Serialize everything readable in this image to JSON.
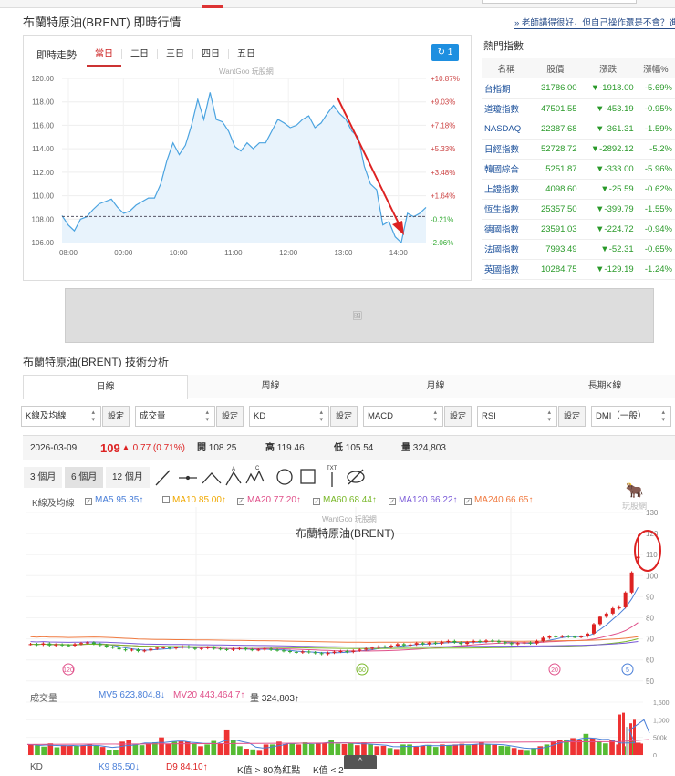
{
  "header": {
    "title": "布蘭特原油(BRENT) 即時行情",
    "promo_link": "» 老師講得很好，但自己操作還是不會？進"
  },
  "intraday": {
    "label": "即時走勢",
    "tabs": [
      "當日",
      "二日",
      "三日",
      "四日",
      "五日"
    ],
    "active_tab": 0,
    "refresh_label": "1",
    "watermark": "WantGoo 玩股網"
  },
  "hot_indices": {
    "title": "熱門指數",
    "columns": [
      "名稱",
      "股價",
      "漲跌",
      "漲幅%"
    ],
    "rows": [
      [
        "台指期",
        "31786.00",
        "▼-1918.00",
        "-5.69%"
      ],
      [
        "道瓊指數",
        "47501.55",
        "▼-453.19",
        "-0.95%"
      ],
      [
        "NASDAQ",
        "22387.68",
        "▼-361.31",
        "-1.59%"
      ],
      [
        "日經指數",
        "52728.72",
        "▼-2892.12",
        "-5.2%"
      ],
      [
        "韓國綜合",
        "5251.87",
        "▼-333.00",
        "-5.96%"
      ],
      [
        "上證指數",
        "4098.60",
        "▼-25.59",
        "-0.62%"
      ],
      [
        "恆生指數",
        "25357.50",
        "▼-399.79",
        "-1.55%"
      ],
      [
        "德國指數",
        "23591.03",
        "▼-224.72",
        "-0.94%"
      ],
      [
        "法國指數",
        "7993.49",
        "▼-52.31",
        "-0.65%"
      ],
      [
        "英國指數",
        "10284.75",
        "▼-129.19",
        "-1.24%"
      ]
    ]
  },
  "tech": {
    "title": "布蘭特原油(BRENT) 技術分析",
    "tabs": [
      "日線",
      "周線",
      "月線",
      "長期K線"
    ],
    "active_tab": 0,
    "selects": [
      {
        "value": "K線及均線",
        "btn": "設定"
      },
      {
        "value": "成交量",
        "btn": "設定"
      },
      {
        "value": "KD",
        "btn": "設定"
      },
      {
        "value": "MACD",
        "btn": "設定"
      },
      {
        "value": "RSI",
        "btn": "設定"
      },
      {
        "value": "DMI（一般）",
        "btn": "設定"
      }
    ],
    "quote": {
      "date": "2026-03-09",
      "price": "109",
      "change": "▲ 0.77 (0.71%)",
      "open_label": "開",
      "open": "108.25",
      "high_label": "高",
      "high": "119.46",
      "low_label": "低",
      "low": "105.54",
      "vol_label": "量",
      "vol": "324,803"
    },
    "ranges": [
      "3 個月",
      "6 個月",
      "12 個月"
    ],
    "active_range": 1,
    "ma_label": "K線及均線",
    "ma": [
      {
        "text": "MA5 95.35↑",
        "checked": true,
        "color": "#4a7fd8"
      },
      {
        "text": "MA10 85.00↑",
        "checked": false,
        "color": "#f0a800"
      },
      {
        "text": "MA20 77.20↑",
        "checked": true,
        "color": "#e0508a"
      },
      {
        "text": "MA60 68.44↑",
        "checked": true,
        "color": "#7ab82a"
      },
      {
        "text": "MA120 66.22↑",
        "checked": true,
        "color": "#7a5ad8"
      },
      {
        "text": "MA240 66.65↑",
        "checked": true,
        "color": "#f07a40"
      }
    ],
    "chart_title": "布蘭特原油(BRENT)",
    "watermark": "WantGoo 玩股網",
    "logo_text": "玩股網",
    "markers": [
      "120",
      "60",
      "20",
      "5"
    ],
    "vol_label": "成交量",
    "mv5": "MV5 623,804.8↓",
    "mv20": "MV20 443,464.7↑",
    "vol_now": "量 324,803↑",
    "kd_label": "KD",
    "k": "K9 85.50↓",
    "d": "D9 84.10↑",
    "kd_note1": "K值 > 80為紅點",
    "kd_note2": "K值 < 2"
  },
  "chart_data": [
    {
      "type": "line",
      "title": "即時走勢",
      "x_ticks": [
        "08:00",
        "09:00",
        "10:00",
        "11:00",
        "12:00",
        "13:00",
        "14:00"
      ],
      "ylim": [
        106,
        120
      ],
      "y_ticks": [
        "106.00",
        "108.00",
        "110.00",
        "112.00",
        "114.00",
        "116.00",
        "118.00",
        "120.00"
      ],
      "pct_ticks": [
        "-2.06%",
        "-0.21%",
        "+1.64%",
        "+3.48%",
        "+5.33%",
        "+7.18%",
        "+9.03%",
        "+10.87%"
      ],
      "reference": 108.23,
      "values": [
        108.3,
        107.5,
        107.0,
        108.0,
        108.2,
        108.8,
        109.3,
        109.5,
        109.7,
        109.0,
        108.5,
        108.7,
        109.2,
        109.5,
        109.8,
        109.8,
        111.0,
        113.0,
        114.5,
        113.5,
        114.3,
        116.0,
        118.2,
        116.5,
        118.8,
        116.5,
        116.3,
        115.5,
        114.2,
        113.8,
        114.5,
        114.0,
        114.5,
        114.5,
        115.5,
        116.5,
        116.2,
        115.8,
        116.0,
        116.5,
        116.8,
        115.8,
        116.2,
        117.0,
        117.7,
        117.0,
        116.5,
        115.5,
        115.0,
        112.5,
        111.0,
        110.5,
        107.5,
        107.8,
        106.5,
        106.0,
        108.5,
        108.2,
        108.5,
        109.0
      ]
    },
    {
      "type": "candlestick",
      "title": "布蘭特原油(BRENT)",
      "ylim": [
        50,
        130
      ],
      "y_ticks": [
        "50",
        "60",
        "70",
        "80",
        "90",
        "100",
        "110",
        "120",
        "130"
      ],
      "closes": [
        67.5,
        67.2,
        67.8,
        66.9,
        67.3,
        67.0,
        66.8,
        67.5,
        68.0,
        68.3,
        67.6,
        67.0,
        66.2,
        65.8,
        65.0,
        64.6,
        64.9,
        64.2,
        64.5,
        65.3,
        65.8,
        66.0,
        65.5,
        65.9,
        66.4,
        65.8,
        65.2,
        65.6,
        66.0,
        65.4,
        65.1,
        64.8,
        65.2,
        65.6,
        65.0,
        64.7,
        64.9,
        65.3,
        64.8,
        64.5,
        64.2,
        63.8,
        63.5,
        64.0,
        63.6,
        63.2,
        62.8,
        63.4,
        63.9,
        64.2,
        63.8,
        64.4,
        64.9,
        65.3,
        65.8,
        66.4,
        66.0,
        66.8,
        67.5,
        66.9,
        67.3,
        68.0,
        67.5,
        68.2,
        67.8,
        68.5,
        69.0,
        68.3,
        67.6,
        68.4,
        69.0,
        68.6,
        69.2,
        69.0,
        68.4,
        68.0,
        67.5,
        67.9,
        68.3,
        67.8,
        69.0,
        70.5,
        71.2,
        71.0,
        71.3,
        71.0,
        70.9,
        71.1,
        72.5,
        77.0,
        80.5,
        82.0,
        84.5,
        85.0,
        92.0,
        101.5,
        109.0
      ],
      "last_high": 119.46,
      "last_low": 105.54,
      "last_open": 108.25
    },
    {
      "type": "bar",
      "title": "成交量",
      "y_ticks": [
        "0",
        "500k",
        "1,000",
        "1,500"
      ],
      "ylim": [
        0,
        1500
      ],
      "values": [
        300,
        280,
        240,
        330,
        220,
        280,
        260,
        270,
        280,
        300,
        260,
        230,
        150,
        140,
        380,
        420,
        300,
        280,
        330,
        360,
        500,
        320,
        380,
        400,
        380,
        330,
        250,
        300,
        400,
        320,
        700,
        420,
        250,
        180,
        160,
        120,
        300,
        300,
        380,
        310,
        340,
        300,
        360,
        310,
        330,
        350,
        420,
        320,
        310,
        330,
        280,
        360,
        310,
        250,
        260,
        200,
        170,
        300,
        300,
        240,
        260,
        290,
        230,
        300,
        280,
        300,
        320,
        280,
        300,
        350,
        300,
        290,
        260,
        250,
        200,
        160,
        120,
        200,
        250,
        300,
        390,
        420,
        440,
        480,
        420,
        600,
        480,
        380,
        330,
        430,
        300,
        250,
        400,
        350
      ]
    }
  ]
}
